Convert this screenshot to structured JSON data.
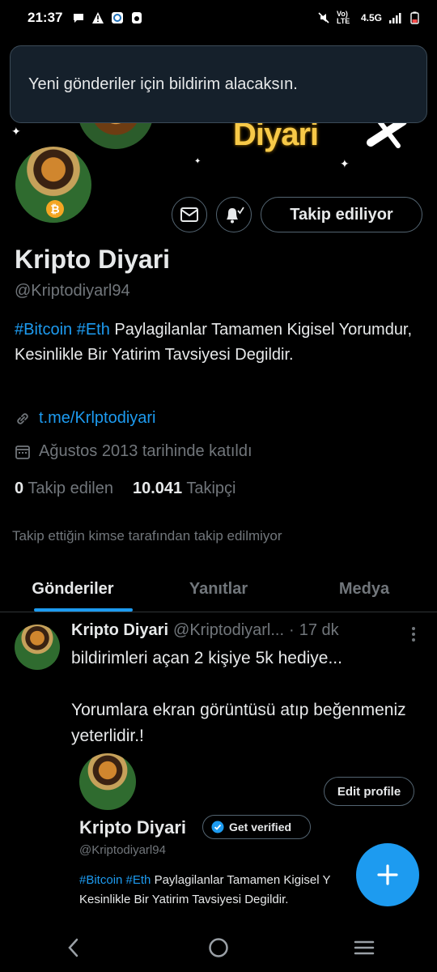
{
  "status_bar": {
    "time": "21:37",
    "network": "4.5G",
    "volte": "Vo) LTE"
  },
  "banner": {
    "title": "Diyari"
  },
  "toast": {
    "message": "Yeni gönderiler için bildirim alacaksın."
  },
  "profile": {
    "follow_button": "Takip ediliyor",
    "display_name": "Kripto Diyari",
    "handle": "@Kriptodiyarl94",
    "bio_tag1": "#Bitcoin",
    "bio_tag2": "#Eth",
    "bio_text": " Paylagilanlar Tamamen Kigisel Yorumdur, Kesinlikle Bir Yatirim Tavsiyesi Degildir.",
    "link": "t.me/Krlptodiyari",
    "joined": "Ağustos 2013 tarihinde katıldı",
    "following_count": "0",
    "following_label": "Takip edilen",
    "followers_count": "10.041",
    "followers_label": "Takipçi",
    "followed_by": "Takip ettiğin kimse tarafından takip edilmiyor"
  },
  "tabs": [
    {
      "label": "Gönderiler"
    },
    {
      "label": "Yanıtlar"
    },
    {
      "label": "Medya"
    }
  ],
  "tweet": {
    "name": "Kripto Diyari",
    "handle": "@Kriptodiyarl...",
    "separator": "·",
    "time_ago": "17 dk",
    "line1": "bildirimleri açan 2 kişiye 5k hediye...",
    "line2": "Yorumlara ekran görüntüsü atıp beğenmeniz yeterlidir.!",
    "embedded": {
      "edit_profile": "Edit profile",
      "name": "Kripto Diyari",
      "get_verified": "Get verified",
      "handle": "@Kriptodiyarl94",
      "bio_tag1": "#Bitcoin",
      "bio_tag2": "#Eth",
      "bio_line1_rest": " Paylagilanlar Tamamen Kigisel Y",
      "bio_line2": "Kesinlikle Bir Yatirim Tavsiyesi Degildir."
    }
  },
  "colors": {
    "accent": "#1d9bf0",
    "background": "#000000",
    "muted": "#71767b",
    "toast_bg": "#15202b"
  },
  "icons": {
    "back": "chevron-left-icon",
    "home": "circle-home-icon",
    "recents": "menu-lines-icon",
    "compose": "plus-icon"
  }
}
